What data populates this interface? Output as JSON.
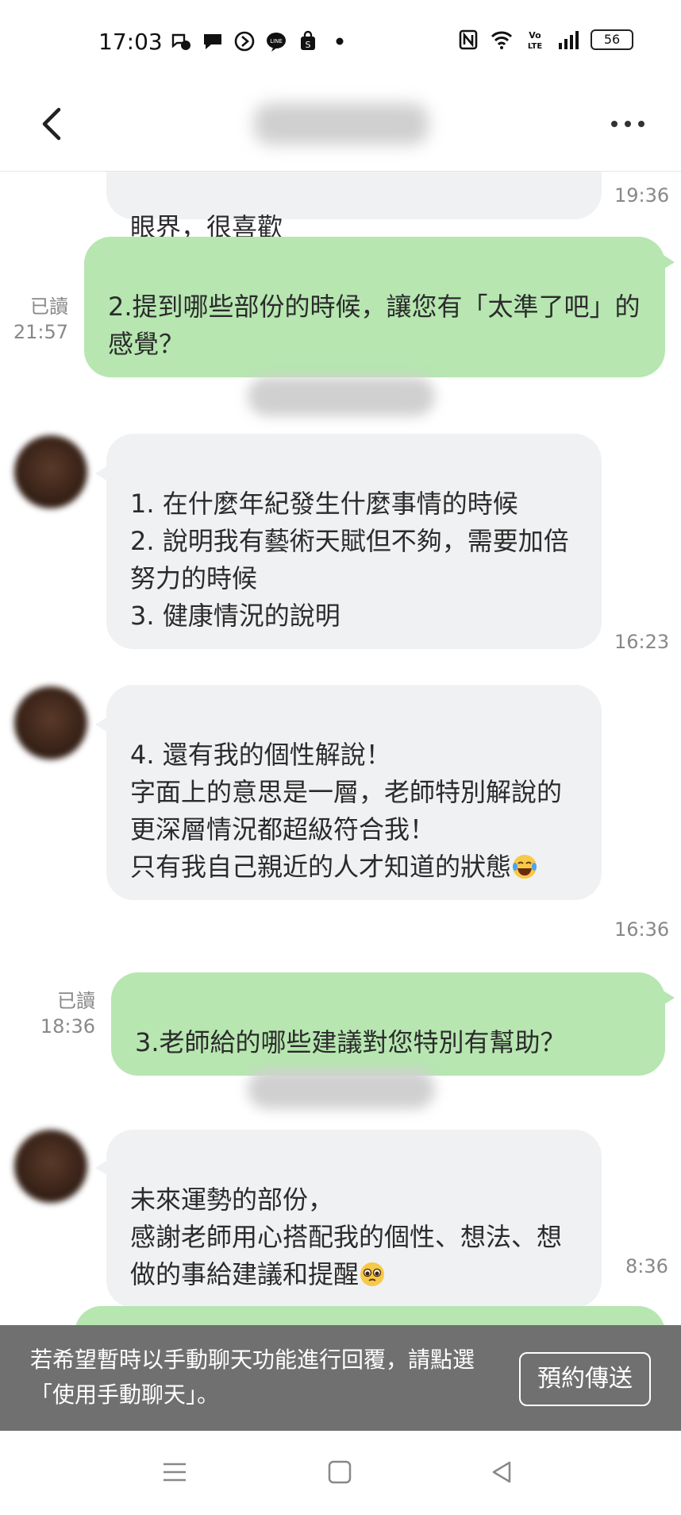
{
  "status_bar": {
    "time": "17:03",
    "battery": "56",
    "volte": "Vo LTE",
    "icons_left": [
      "messenger-icon",
      "chat-bubble-icon",
      "play-circle-icon",
      "line-icon",
      "shop-bag-icon",
      "dot-icon"
    ],
    "icons_right": [
      "nfc-icon",
      "wifi-icon",
      "volte-icon",
      "signal-icon",
      "battery-icon"
    ]
  },
  "header": {
    "back_icon": "chevron-left-icon",
    "more_icon": "more-horizontal-icon"
  },
  "messages": [
    {
      "id": "m0",
      "direction": "in",
      "text": "眼界，很喜歡",
      "time": "19:36"
    },
    {
      "id": "m1",
      "direction": "out",
      "text": "2.提到哪些部份的時候，讓您有「太準了吧」的感覺？",
      "read": "已讀",
      "time": "21:57"
    },
    {
      "id": "m2",
      "direction": "in",
      "text": "1. 在什麼年紀發生什麼事情的時候\n2. 說明我有藝術天賦但不夠，需要加倍努力的時候\n3. 健康情況的說明",
      "time": "16:23"
    },
    {
      "id": "m3",
      "direction": "in",
      "text": "4. 還有我的個性解說！\n字面上的意思是一層，老師特別解說的更深層情況都超級符合我！\n只有我自己親近的人才知道的狀態",
      "emoji": "laughing-tears-emoji",
      "time": "16:36"
    },
    {
      "id": "m4",
      "direction": "out",
      "text": "3.老師給的哪些建議對您特別有幫助？",
      "read": "已讀",
      "time": "18:36"
    },
    {
      "id": "m5",
      "direction": "in",
      "text": "未來運勢的部份，\n感謝老師用心搭配我的個性、想法、想做的事給建議和提醒",
      "emoji": "pleading-face-emoji",
      "time": "8:36"
    }
  ],
  "notice": {
    "text": "若希望暫時以手動聊天功能進行回覆，請點選「使用手動聊天」。",
    "button_label": "預約傳送"
  },
  "colors": {
    "outgoing_bubble": "#b7e6b1",
    "incoming_bubble": "#f0f1f3",
    "notice_bg": "#707070",
    "timestamp": "#888888"
  },
  "nav_bar": {
    "icons": [
      "menu-icon",
      "home-square-icon",
      "back-triangle-icon"
    ]
  }
}
